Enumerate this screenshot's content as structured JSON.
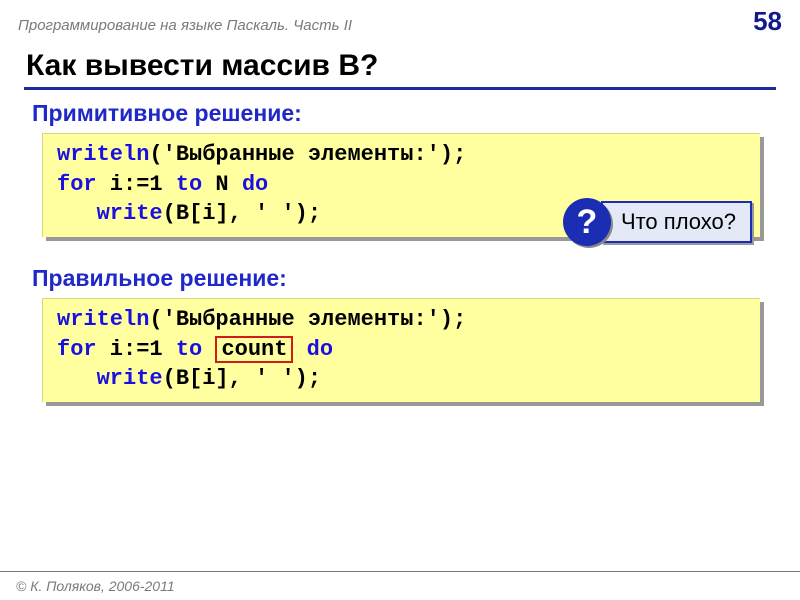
{
  "header": {
    "course_title": "Программирование на языке Паскаль. Часть II",
    "page_number": "58"
  },
  "title": "Как вывести массив B?",
  "block1": {
    "heading": "Примитивное решение:",
    "code": {
      "line1_kw": "writeln",
      "line1_rest": "('Выбранные элементы:');",
      "line2_kw1": "for",
      "line2_mid": " i:=1 ",
      "line2_kw2": "to",
      "line2_rest": " N ",
      "line2_kw3": "do",
      "line3_pad": "   ",
      "line3_kw": "write",
      "line3_rest": "(B[i], ' ');"
    }
  },
  "callout": {
    "mark": "?",
    "text": "Что плохо?"
  },
  "block2": {
    "heading": "Правильное решение:",
    "code": {
      "line1_kw": "writeln",
      "line1_rest": "('Выбранные элементы:');",
      "line2_kw1": "for",
      "line2_mid": " i:=1 ",
      "line2_kw2": "to",
      "line2_before_count": " ",
      "line2_count": "count",
      "line2_after_count": " ",
      "line2_kw3": "do",
      "line3_pad": "   ",
      "line3_kw": "write",
      "line3_rest": "(B[i], ' ');"
    }
  },
  "footer": "© К. Поляков, 2006-2011"
}
